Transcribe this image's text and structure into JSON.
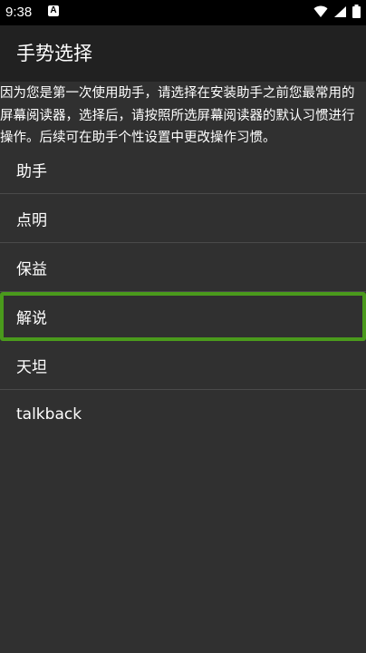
{
  "status_bar": {
    "time": "9:38",
    "notification_icon": "A"
  },
  "app_bar": {
    "title": "手势选择"
  },
  "notice": {
    "text": "因为您是第一次使用助手，请选择在安装助手之前您最常用的屏幕阅读器，选择后，请按照所选屏幕阅读器的默认习惯进行操作。后续可在助手个性设置中更改操作习惯。"
  },
  "options": [
    {
      "label": "助手"
    },
    {
      "label": "点明"
    },
    {
      "label": "保益"
    },
    {
      "label": "解说"
    },
    {
      "label": "天坦"
    },
    {
      "label": "talkback"
    }
  ],
  "focused_option": "解说",
  "colors": {
    "background": "#303030",
    "app_bar": "#212121",
    "status_bar": "#000000",
    "focus_outline": "#4a9a1c"
  }
}
